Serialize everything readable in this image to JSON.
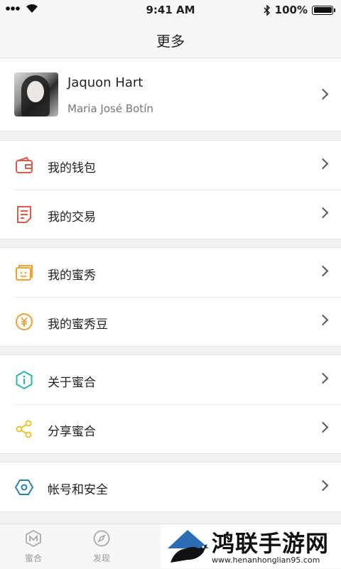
{
  "status_bar": {
    "time": "9:41 AM",
    "battery": "100%"
  },
  "nav": {
    "title": "更多"
  },
  "profile": {
    "name": "Jaquon Hart",
    "subname": "Maria José Botín"
  },
  "groups": [
    {
      "items": [
        {
          "label": "我的钱包",
          "icon": "wallet-icon"
        },
        {
          "label": "我的交易",
          "icon": "document-icon"
        }
      ]
    },
    {
      "items": [
        {
          "label": "我的蜜秀",
          "icon": "smile-card-icon"
        },
        {
          "label": "我的蜜秀豆",
          "icon": "yen-coin-icon"
        }
      ]
    },
    {
      "items": [
        {
          "label": "关于蜜合",
          "icon": "info-hexagon-icon"
        },
        {
          "label": "分享蜜合",
          "icon": "share-icon"
        }
      ]
    },
    {
      "items": [
        {
          "label": "帐号和安全",
          "icon": "security-hexagon-icon"
        }
      ]
    }
  ],
  "tabs": [
    {
      "label": "蜜合",
      "icon": "m-hexagon-icon"
    },
    {
      "label": "发现",
      "icon": "compass-icon"
    }
  ],
  "watermark": {
    "brand": "鸿联手游网",
    "url": "www.henanhonglian95.com"
  },
  "colors": {
    "wallet": "#e05a4a",
    "document": "#e05a4a",
    "smile": "#f0a030",
    "yen": "#f0a030",
    "info": "#2bb5a8",
    "share": "#f0c030",
    "security": "#2b7fb5"
  }
}
